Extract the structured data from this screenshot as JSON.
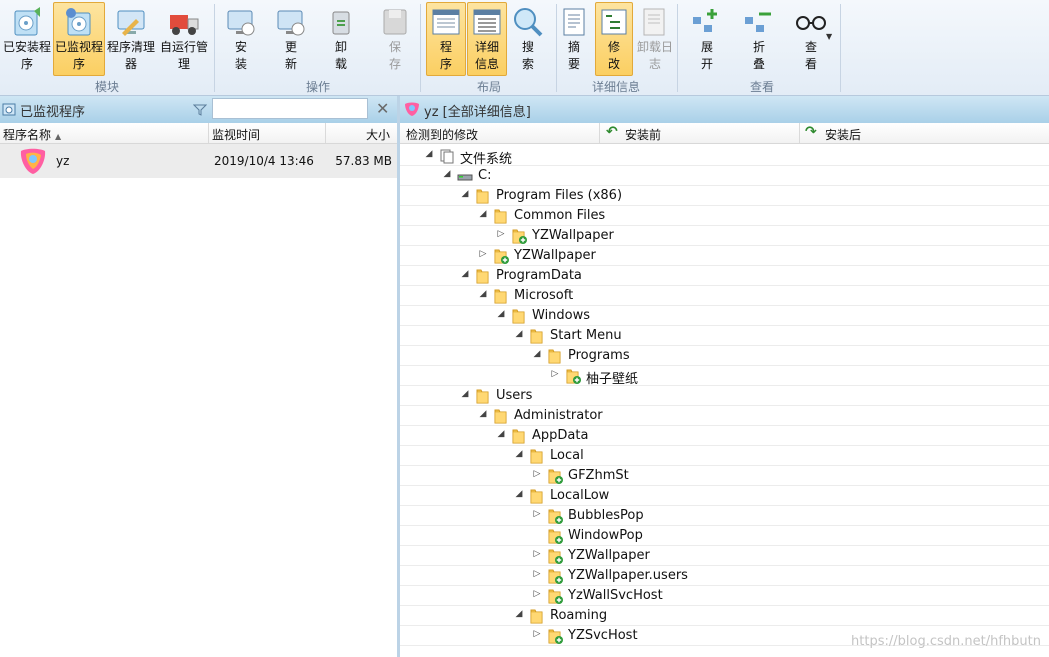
{
  "ribbon": {
    "groups": [
      {
        "label": "模块"
      },
      {
        "label": "操作"
      },
      {
        "label": "布局"
      },
      {
        "label": "详细信息"
      },
      {
        "label": "查看"
      }
    ],
    "buttons": [
      {
        "label": "已安装程序",
        "icon": "installed-programs-icon",
        "active": false,
        "disabled": false
      },
      {
        "label": "已监视程序",
        "icon": "monitored-programs-icon",
        "active": true,
        "disabled": false
      },
      {
        "label": "程序清理器",
        "icon": "program-cleaner-icon",
        "active": false,
        "disabled": false
      },
      {
        "label": "自运行管理",
        "icon": "autorun-manager-icon",
        "active": false,
        "disabled": false
      },
      {
        "label": "安装",
        "icon": "install-icon",
        "active": false,
        "disabled": false
      },
      {
        "label": "更新",
        "icon": "update-icon",
        "active": false,
        "disabled": false
      },
      {
        "label": "卸载",
        "icon": "uninstall-icon",
        "active": false,
        "disabled": false
      },
      {
        "label": "保存",
        "icon": "save-icon",
        "active": false,
        "disabled": true
      },
      {
        "label": "程序",
        "icon": "program-layout-icon",
        "active": true,
        "disabled": false
      },
      {
        "label": "详细信息",
        "icon": "details-layout-icon",
        "active": true,
        "disabled": false
      },
      {
        "label": "搜索",
        "icon": "search-icon",
        "active": false,
        "disabled": false
      },
      {
        "label": "摘要",
        "icon": "summary-icon",
        "active": false,
        "disabled": false
      },
      {
        "label": "修改",
        "icon": "modifications-icon",
        "active": true,
        "disabled": false
      },
      {
        "label": "卸载日志",
        "icon": "uninstall-log-icon",
        "active": false,
        "disabled": true
      },
      {
        "label": "展开",
        "icon": "expand-icon",
        "active": false,
        "disabled": false
      },
      {
        "label": "折叠",
        "icon": "collapse-icon",
        "active": false,
        "disabled": false
      },
      {
        "label": "查看",
        "icon": "view-glasses-icon",
        "active": false,
        "disabled": false
      }
    ]
  },
  "left_panel": {
    "title": "已监视程序",
    "search": {
      "value": "",
      "placeholder": ""
    },
    "columns": {
      "name": "程序名称",
      "time": "监视时间",
      "size": "大小"
    },
    "programs": [
      {
        "name": "yz",
        "time": "2019/10/4 13:46",
        "size": "57.83 MB"
      }
    ]
  },
  "right_panel": {
    "title": "yz [全部详细信息]",
    "columns": {
      "changes": "检测到的修改",
      "before": "安装前",
      "after": "安装后"
    },
    "tree": [
      {
        "label": "文件系统",
        "kind": "filesystem",
        "expand": "open"
      },
      {
        "label": "C:",
        "kind": "drive",
        "expand": "open"
      },
      {
        "label": "Program Files (x86)",
        "kind": "folder",
        "expand": "open"
      },
      {
        "label": "Common Files",
        "kind": "folder",
        "expand": "open"
      },
      {
        "label": "YZWallpaper",
        "kind": "folder-added",
        "expand": "closed"
      },
      {
        "label": "YZWallpaper",
        "kind": "folder-added",
        "expand": "closed"
      },
      {
        "label": "ProgramData",
        "kind": "folder",
        "expand": "open"
      },
      {
        "label": "Microsoft",
        "kind": "folder",
        "expand": "open"
      },
      {
        "label": "Windows",
        "kind": "folder",
        "expand": "open"
      },
      {
        "label": "Start Menu",
        "kind": "folder",
        "expand": "open"
      },
      {
        "label": "Programs",
        "kind": "folder",
        "expand": "open"
      },
      {
        "label": "柚子壁纸",
        "kind": "folder-added",
        "expand": "closed"
      },
      {
        "label": "Users",
        "kind": "folder",
        "expand": "open"
      },
      {
        "label": "Administrator",
        "kind": "folder",
        "expand": "open"
      },
      {
        "label": "AppData",
        "kind": "folder",
        "expand": "open"
      },
      {
        "label": "Local",
        "kind": "folder",
        "expand": "open"
      },
      {
        "label": "GFZhmSt",
        "kind": "folder-added",
        "expand": "closed"
      },
      {
        "label": "LocalLow",
        "kind": "folder",
        "expand": "open"
      },
      {
        "label": "BubblesPop",
        "kind": "folder-added",
        "expand": "closed"
      },
      {
        "label": "WindowPop",
        "kind": "folder-added",
        "expand": "none"
      },
      {
        "label": "YZWallpaper",
        "kind": "folder-added",
        "expand": "closed"
      },
      {
        "label": "YZWallpaper.users",
        "kind": "folder-added",
        "expand": "closed"
      },
      {
        "label": "YzWallSvcHost",
        "kind": "folder-added",
        "expand": "closed"
      },
      {
        "label": "Roaming",
        "kind": "folder",
        "expand": "open"
      },
      {
        "label": "YZSvcHost",
        "kind": "folder-added",
        "expand": "closed"
      }
    ]
  },
  "watermark": "https://blog.csdn.net/hfhbutn",
  "colors": {
    "ribbon_active": "#fbcf62",
    "panel_header": "#a9d0e8",
    "folder": "#f3c44d",
    "added_badge": "#2e9b3a"
  }
}
